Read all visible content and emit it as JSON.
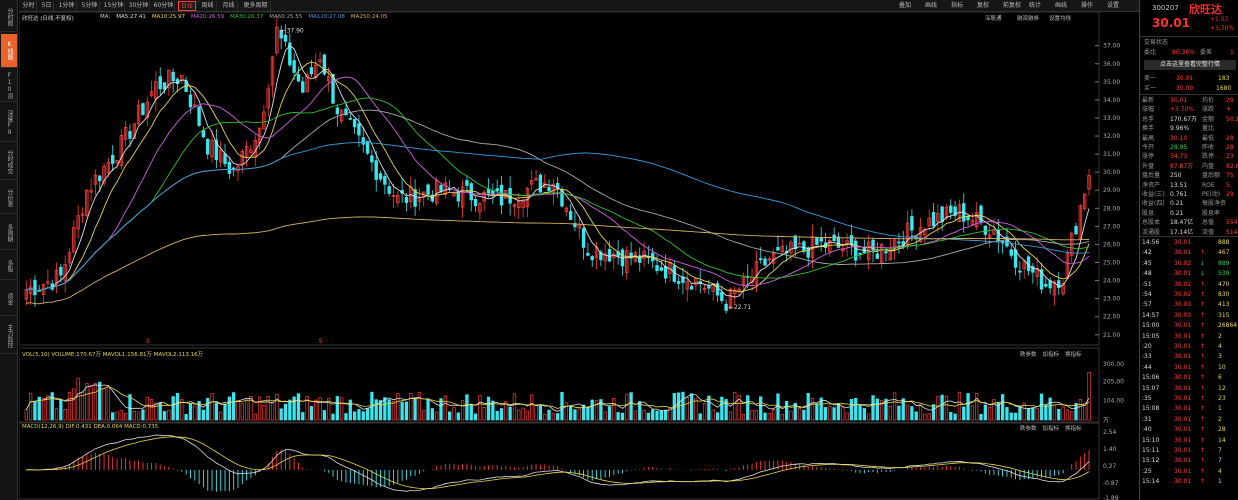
{
  "left_tabs": [
    {
      "label": "分时图",
      "active": false
    },
    {
      "label": "K线图",
      "active": true
    },
    {
      "label": "F10资料",
      "active": false
    },
    {
      "label": "深度F9",
      "active": false
    },
    {
      "label": "分时成交",
      "active": false
    },
    {
      "label": "分价表",
      "active": false
    },
    {
      "label": "多周期",
      "active": false
    },
    {
      "label": "多股",
      "active": false
    },
    {
      "label": "资金",
      "active": false
    },
    {
      "label": "主力监控",
      "active": false
    }
  ],
  "toolbar": {
    "periods": [
      {
        "label": "分时",
        "active": false
      },
      {
        "label": "5日",
        "active": false
      },
      {
        "label": "1分钟",
        "active": false
      },
      {
        "label": "5分钟",
        "active": false
      },
      {
        "label": "15分钟",
        "active": false
      },
      {
        "label": "30分钟",
        "active": false
      },
      {
        "label": "60分钟",
        "active": false
      },
      {
        "label": "日线",
        "active": true
      },
      {
        "label": "周线",
        "active": false
      },
      {
        "label": "月线",
        "active": false
      },
      {
        "label": "更多周期",
        "active": false
      }
    ],
    "right_items": [
      "叠加",
      "画线",
      "指标",
      "复权",
      "前复权",
      "统计",
      "画线",
      "操作",
      "设置"
    ],
    "sub_items": [
      "深股通",
      "融资融券",
      "设置均线"
    ]
  },
  "main_chart": {
    "stock_label": "欣旺达",
    "adjust_label": "(日线,不复权)",
    "ma_legend": [
      {
        "text": "MA:",
        "color": "#d0d0d0"
      },
      {
        "text": "MA5:27.41",
        "color": "#e0e0e0"
      },
      {
        "text": "MA10:25.97",
        "color": "#e8d84a"
      },
      {
        "text": "MA20:26.59",
        "color": "#d060e0"
      },
      {
        "text": "MA30:26.37",
        "color": "#30c030"
      },
      {
        "text": "MA60:25.55",
        "color": "#aaaaaa"
      },
      {
        "text": "MA120:27.08",
        "color": "#3a9ad9"
      },
      {
        "text": "MA250:24.05",
        "color": "#d8b060"
      }
    ],
    "high_label": "37.90",
    "low_label": "22.71",
    "y_ticks": [
      "37.00",
      "36.00",
      "35.00",
      "34.00",
      "33.00",
      "32.00",
      "31.00",
      "30.00",
      "29.00",
      "28.00",
      "27.00",
      "26.00",
      "25.00",
      "24.00",
      "23.00",
      "22.00",
      "21.00"
    ],
    "s_markers": [
      "S",
      "S"
    ]
  },
  "volume_panel": {
    "legend": "VOL(5,10)  VOLUME:170.67万  MAVOL1:156.81万  MAVOL2:113.16万",
    "y_ticks": [
      "300.00",
      "205.00",
      "104.00"
    ],
    "unit": "万",
    "buttons": [
      "跌参数",
      "加指标",
      "换指标"
    ]
  },
  "macd_panel": {
    "legend": "MACD(12,26,9)  DIF:0.431  DEA:0.064  MACD:0.735",
    "y_ticks": [
      "2.54",
      "1.40",
      "0.27",
      "-0.87",
      "-1.89"
    ],
    "buttons": [
      "跌参数",
      "加指标",
      "换指标"
    ]
  },
  "right_panel": {
    "code": "300207",
    "name": "欣旺达",
    "price": "30.01",
    "change": "+1.07",
    "change_pct": "+3.70%",
    "status_label": "交易状态",
    "weibi_label": "委比",
    "weibi_value": "80.36%",
    "weicha_label": "委差",
    "weicha_value": "1",
    "ad_text": "点击这里查看完整行情",
    "sell1": {
      "label": "卖一",
      "price": "30.01",
      "vol": "183"
    },
    "buy1": {
      "label": "买一",
      "price": "30.00",
      "vol": "1680"
    },
    "quotes": [
      {
        "l": "最新",
        "v": "30.01",
        "l2": "均价",
        "v2": "29",
        "c": "red"
      },
      {
        "l": "涨幅",
        "v": "+3.70%",
        "l2": "涨跌",
        "v2": "+",
        "c": "red"
      },
      {
        "l": "总手",
        "v": "170.67万",
        "l2": "金额",
        "v2": "50.1",
        "c": "white"
      },
      {
        "l": "换手",
        "v": "9.96%",
        "l2": "量比",
        "v2": "",
        "c": "white"
      },
      {
        "l": "最高",
        "v": "30.10",
        "l2": "最低",
        "v2": "28",
        "c": "red"
      },
      {
        "l": "今开",
        "v": "28.95",
        "l2": "昨收",
        "v2": "28",
        "c": "green"
      },
      {
        "l": "涨停",
        "v": "34.73",
        "l2": "跌停",
        "v2": "23",
        "c": "red"
      },
      {
        "l": "外盘",
        "v": "87.87万",
        "l2": "内盘",
        "v2": "82.8",
        "c": "red"
      },
      {
        "l": "盘后量",
        "v": "250",
        "l2": "盘后额",
        "v2": "75",
        "c": "white"
      },
      {
        "l": "净资产",
        "v": "13.51",
        "l2": "ROE",
        "v2": "5.",
        "c": "white"
      },
      {
        "l": "收益(三)",
        "v": "0.761",
        "l2": "PE(动)",
        "v2": "29",
        "c": "white"
      },
      {
        "l": "收益(四)",
        "v": "0.21",
        "l2": "每股净资",
        "v2": "",
        "c": "white"
      },
      {
        "l": "股息",
        "v": "0.21",
        "l2": "股息率",
        "v2": "",
        "c": "white"
      },
      {
        "l": "总股本",
        "v": "18.47亿",
        "l2": "总值",
        "v2": "554.",
        "c": "white"
      },
      {
        "l": "流通股",
        "v": "17.14亿",
        "l2": "流值",
        "v2": "514.",
        "c": "white"
      }
    ],
    "ticks": [
      {
        "t": "14:56",
        "p": "30.01",
        "v": "888",
        "c": "yellow"
      },
      {
        "t": ":42",
        "p": "30.01",
        "v": "467",
        "c": "red"
      },
      {
        "t": ":45",
        "p": "30.02",
        "v": "889",
        "c": "green"
      },
      {
        "t": ":48",
        "p": "30.01",
        "v": "539",
        "c": "green"
      },
      {
        "t": ":51",
        "p": "30.02",
        "v": "470",
        "c": "red"
      },
      {
        "t": ":54",
        "p": "30.02",
        "v": "830",
        "c": "red"
      },
      {
        "t": ":57",
        "p": "30.03",
        "v": "413",
        "c": "red"
      },
      {
        "t": "14:57",
        "p": "30.03",
        "v": "315",
        "c": "red"
      },
      {
        "t": "15:00",
        "p": "30.01",
        "v": "26864",
        "c": "red"
      },
      {
        "t": "15:05",
        "p": "30.01",
        "v": "2",
        "c": "red"
      },
      {
        "t": ":20",
        "p": "30.01",
        "v": "4",
        "c": "red"
      },
      {
        "t": ":33",
        "p": "30.01",
        "v": "3",
        "c": "red"
      },
      {
        "t": ":44",
        "p": "30.01",
        "v": "10",
        "c": "red"
      },
      {
        "t": "15:06",
        "p": "30.01",
        "v": "6",
        "c": "red"
      },
      {
        "t": "15:07",
        "p": "30.01",
        "v": "12",
        "c": "red"
      },
      {
        "t": ":35",
        "p": "30.01",
        "v": "23",
        "c": "red"
      },
      {
        "t": "15:08",
        "p": "30.01",
        "v": "1",
        "c": "red"
      },
      {
        "t": ":31",
        "p": "30.01",
        "v": "2",
        "c": "red"
      },
      {
        "t": ":40",
        "p": "30.01",
        "v": "28",
        "c": "red"
      },
      {
        "t": "15:10",
        "p": "30.01",
        "v": "14",
        "c": "red"
      },
      {
        "t": "15:11",
        "p": "30.01",
        "v": "7",
        "c": "red"
      },
      {
        "t": "15:12",
        "p": "30.01",
        "v": "7",
        "c": "red"
      },
      {
        "t": ":25",
        "p": "30.01",
        "v": "4",
        "c": "red"
      },
      {
        "t": "15:14",
        "p": "30.01",
        "v": "1",
        "c": "red"
      }
    ]
  }
}
